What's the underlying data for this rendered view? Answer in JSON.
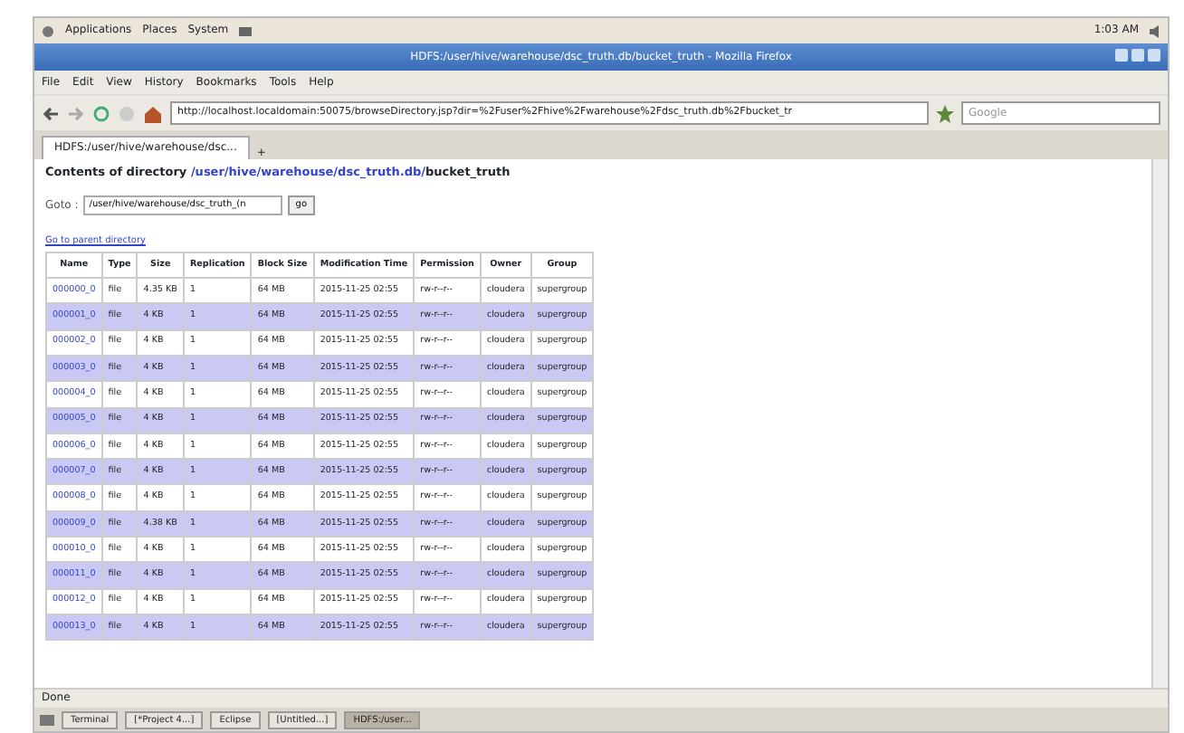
{
  "panel": {
    "menus": [
      "Applications",
      "Places",
      "System"
    ],
    "clock": "1:03 AM"
  },
  "window": {
    "title": "HDFS:/user/hive/warehouse/dsc_truth.db/bucket_truth - Mozilla Firefox"
  },
  "menu_bar": [
    "File",
    "Edit",
    "View",
    "History",
    "Bookmarks",
    "Tools",
    "Help"
  ],
  "toolbar": {
    "url": "http://localhost.localdomain:50075/browseDirectory.jsp?dir=%2Fuser%2Fhive%2Fwarehouse%2Fdsc_truth.db%2Fbucket_tr",
    "search_placeholder": "Google"
  },
  "tabs": [
    {
      "label": "HDFS:/user/hive/warehouse/dsc...",
      "selected": true
    }
  ],
  "new_tab": "+",
  "page": {
    "heading": "Contents of directory",
    "path_link": "/user/hive/warehouse/dsc_truth.db/",
    "path_rest": "bucket_truth",
    "goto_label": "Goto :",
    "goto_value": "/user/hive/warehouse/dsc_truth_(n",
    "go_button": "go",
    "parent_link": "Go to parent directory"
  },
  "table": {
    "columns": [
      "Name",
      "Type",
      "Size",
      "Replication",
      "Block Size",
      "Modification Time",
      "Permission",
      "Owner",
      "Group"
    ],
    "rows": [
      [
        "000000_0",
        "file",
        "4.35 KB",
        "1",
        "64 MB",
        "2015-11-25 02:55",
        "rw-r--r--",
        "cloudera",
        "supergroup"
      ],
      [
        "000001_0",
        "file",
        "4 KB",
        "1",
        "64 MB",
        "2015-11-25 02:55",
        "rw-r--r--",
        "cloudera",
        "supergroup"
      ],
      [
        "000002_0",
        "file",
        "4 KB",
        "1",
        "64 MB",
        "2015-11-25 02:55",
        "rw-r--r--",
        "cloudera",
        "supergroup"
      ],
      [
        "000003_0",
        "file",
        "4 KB",
        "1",
        "64 MB",
        "2015-11-25 02:55",
        "rw-r--r--",
        "cloudera",
        "supergroup"
      ],
      [
        "000004_0",
        "file",
        "4 KB",
        "1",
        "64 MB",
        "2015-11-25 02:55",
        "rw-r--r--",
        "cloudera",
        "supergroup"
      ],
      [
        "000005_0",
        "file",
        "4 KB",
        "1",
        "64 MB",
        "2015-11-25 02:55",
        "rw-r--r--",
        "cloudera",
        "supergroup"
      ],
      [
        "000006_0",
        "file",
        "4 KB",
        "1",
        "64 MB",
        "2015-11-25 02:55",
        "rw-r--r--",
        "cloudera",
        "supergroup"
      ],
      [
        "000007_0",
        "file",
        "4 KB",
        "1",
        "64 MB",
        "2015-11-25 02:55",
        "rw-r--r--",
        "cloudera",
        "supergroup"
      ],
      [
        "000008_0",
        "file",
        "4 KB",
        "1",
        "64 MB",
        "2015-11-25 02:55",
        "rw-r--r--",
        "cloudera",
        "supergroup"
      ],
      [
        "000009_0",
        "file",
        "4.38 KB",
        "1",
        "64 MB",
        "2015-11-25 02:55",
        "rw-r--r--",
        "cloudera",
        "supergroup"
      ],
      [
        "000010_0",
        "file",
        "4 KB",
        "1",
        "64 MB",
        "2015-11-25 02:55",
        "rw-r--r--",
        "cloudera",
        "supergroup"
      ],
      [
        "000011_0",
        "file",
        "4 KB",
        "1",
        "64 MB",
        "2015-11-25 02:55",
        "rw-r--r--",
        "cloudera",
        "supergroup"
      ],
      [
        "000012_0",
        "file",
        "4 KB",
        "1",
        "64 MB",
        "2015-11-25 02:55",
        "rw-r--r--",
        "cloudera",
        "supergroup"
      ],
      [
        "000013_0",
        "file",
        "4 KB",
        "1",
        "64 MB",
        "2015-11-25 02:55",
        "rw-r--r--",
        "cloudera",
        "supergroup"
      ]
    ]
  },
  "status_bar": "Done",
  "taskbar": [
    {
      "label": "Terminal",
      "selected": false
    },
    {
      "label": "[*Project 4...]",
      "selected": false
    },
    {
      "label": "Eclipse",
      "selected": false
    },
    {
      "label": "[Untitled...]",
      "selected": false
    },
    {
      "label": "HDFS:/user...",
      "selected": true
    }
  ]
}
